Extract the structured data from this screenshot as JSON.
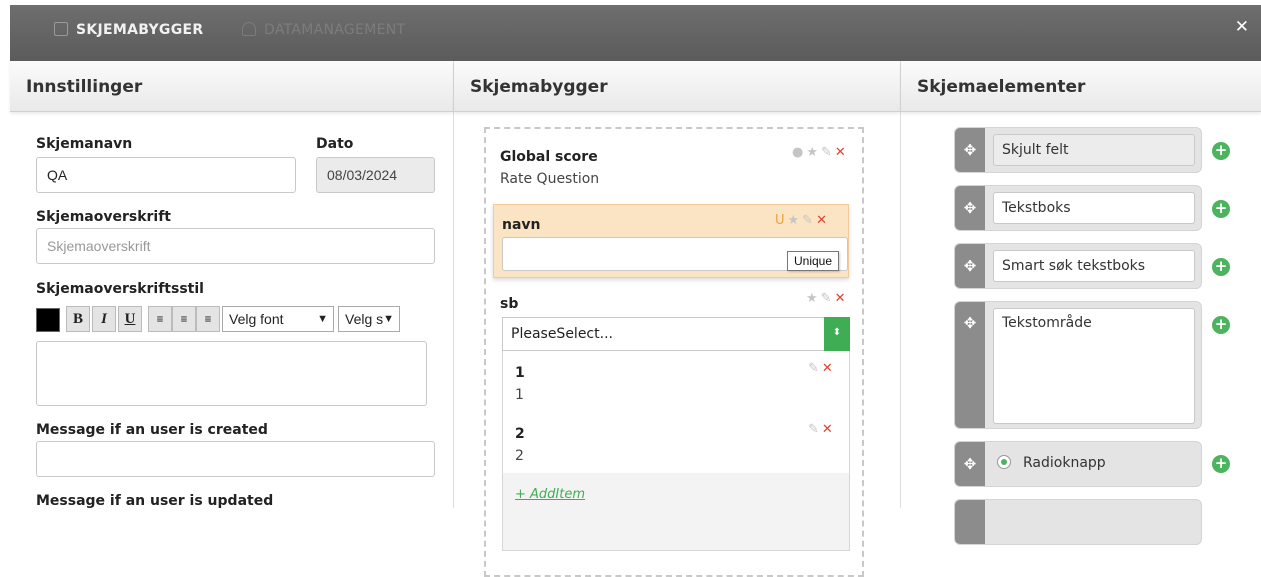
{
  "header": {
    "tabs": [
      {
        "label": "SKJEMABYGGER",
        "icon": "clipboard-check-icon",
        "active": true
      },
      {
        "label": "DATAMANAGEMENT",
        "icon": "database-icon",
        "active": false
      }
    ],
    "close_label": "✕"
  },
  "settings": {
    "title": "Innstillinger",
    "name_label": "Skjemanavn",
    "name_value": "QA",
    "date_label": "Dato",
    "date_value": "08/03/2024",
    "heading_label": "Skjemaoverskrift",
    "heading_placeholder": "Skjemaoverskrift",
    "style_label": "Skjemaoverskriftsstil",
    "toolbar": {
      "color": "#000000",
      "bold": "B",
      "italic": "I",
      "underline": "U",
      "font_select": "Velg font",
      "size_select": "Velg s"
    },
    "created_label": "Message if an user is created",
    "updated_label": "Message if an user is updated"
  },
  "builder": {
    "title": "Skjemabygger",
    "q1": {
      "title": "Global score",
      "subtitle": "Rate Question"
    },
    "q2": {
      "title": "navn",
      "unique_marker": "U"
    },
    "tooltip": "Unique",
    "q3": {
      "title": "sb",
      "select_placeholder": "PleaseSelect...",
      "options": [
        {
          "title": "1",
          "value": "1"
        },
        {
          "title": "2",
          "value": "2"
        }
      ],
      "add_item": "+ AddItem"
    }
  },
  "elements": {
    "title": "Skjemaelementer",
    "items": [
      {
        "label": "Skjult felt",
        "icon": "move-icon"
      },
      {
        "label": "Tekstboks",
        "icon": "move-icon"
      },
      {
        "label": "Smart søk tekstboks",
        "icon": "move-icon"
      },
      {
        "label": "Tekstområde",
        "icon": "move-icon"
      },
      {
        "label": "Radioknapp",
        "icon": "move-icon"
      }
    ]
  },
  "colors": {
    "header_bg": "#5f5f5f",
    "accent_green": "#4cb35e",
    "delete_red": "#e0432f",
    "highlight_bg": "#fbe4c3"
  }
}
